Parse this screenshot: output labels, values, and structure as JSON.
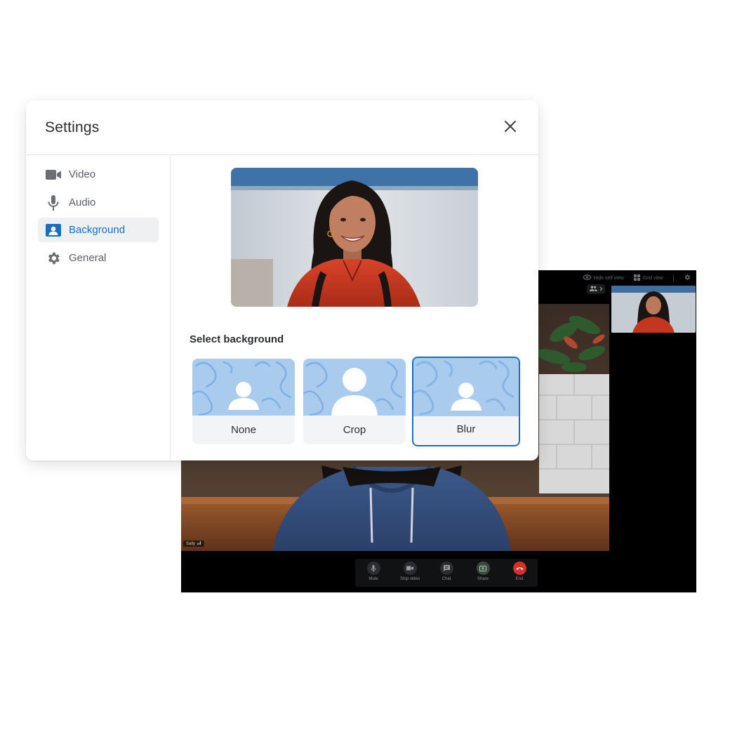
{
  "call": {
    "topbar": {
      "hide_self_view": "Hide self view",
      "grid_view": "Grid view"
    },
    "name_tag": "Sally",
    "controls": [
      {
        "label": "Mute",
        "icon": "microphone-icon"
      },
      {
        "label": "Stop video",
        "icon": "camera-icon"
      },
      {
        "label": "Chat",
        "icon": "chat-icon"
      },
      {
        "label": "Share",
        "icon": "share-screen-icon"
      },
      {
        "label": "End",
        "icon": "hang-up-icon"
      }
    ]
  },
  "settings": {
    "title": "Settings",
    "nav": [
      {
        "label": "Video",
        "icon": "video-camera-icon"
      },
      {
        "label": "Audio",
        "icon": "microphone-icon"
      },
      {
        "label": "Background",
        "icon": "person-card-icon",
        "active": true
      },
      {
        "label": "General",
        "icon": "gear-icon"
      }
    ],
    "select_background_title": "Select background",
    "options": [
      {
        "label": "None"
      },
      {
        "label": "Crop"
      },
      {
        "label": "Blur",
        "selected": true
      }
    ]
  },
  "colors": {
    "accent": "#1a6cc4",
    "thumb_bg": "#a9cbee",
    "end_call": "#d93025"
  }
}
